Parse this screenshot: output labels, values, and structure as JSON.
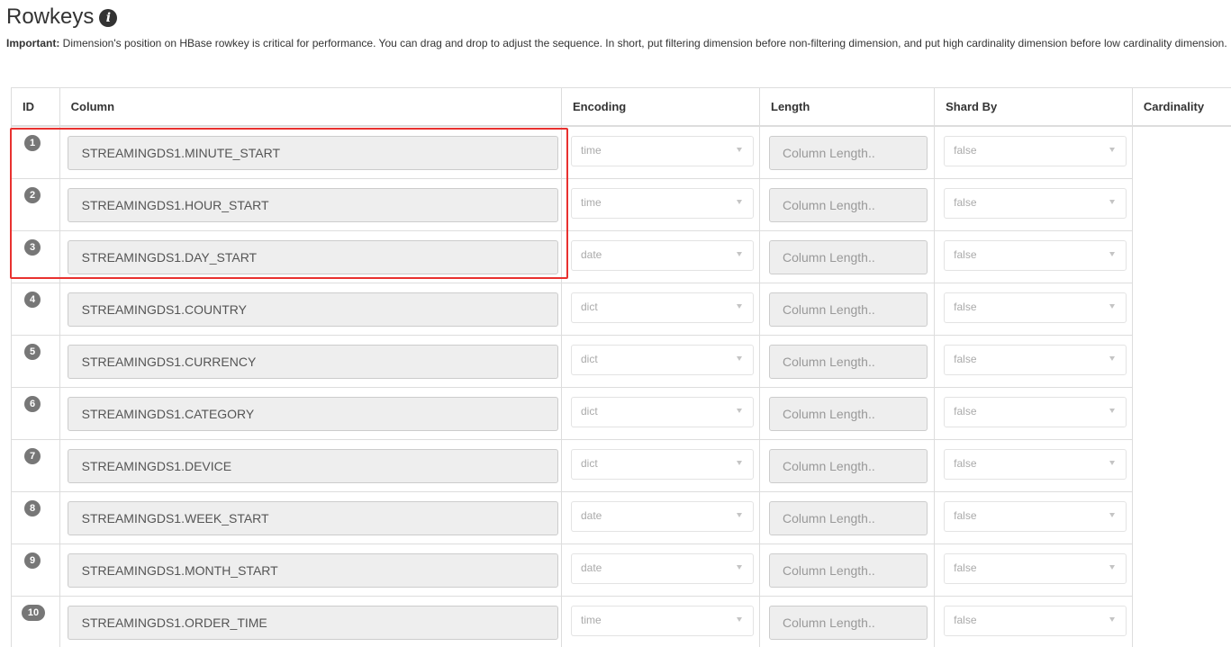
{
  "header": {
    "title": "Rowkeys",
    "info_icon": "info-circle-icon",
    "note_label": "Important:",
    "note_text": " Dimension's position on HBase rowkey is critical for performance. You can drag and drop to adjust the sequence. In short, put filtering dimension before non-filtering dimension, and put high cardinality dimension before low cardinality dimension."
  },
  "table": {
    "columns": [
      "ID",
      "Column",
      "Encoding",
      "Length",
      "Shard By",
      "Cardinality"
    ],
    "length_placeholder": "Column Length..",
    "rows": [
      {
        "id": "1",
        "column": "STREAMINGDS1.MINUTE_START",
        "encoding": "time",
        "shard_by": "false"
      },
      {
        "id": "2",
        "column": "STREAMINGDS1.HOUR_START",
        "encoding": "time",
        "shard_by": "false"
      },
      {
        "id": "3",
        "column": "STREAMINGDS1.DAY_START",
        "encoding": "date",
        "shard_by": "false"
      },
      {
        "id": "4",
        "column": "STREAMINGDS1.COUNTRY",
        "encoding": "dict",
        "shard_by": "false"
      },
      {
        "id": "5",
        "column": "STREAMINGDS1.CURRENCY",
        "encoding": "dict",
        "shard_by": "false"
      },
      {
        "id": "6",
        "column": "STREAMINGDS1.CATEGORY",
        "encoding": "dict",
        "shard_by": "false"
      },
      {
        "id": "7",
        "column": "STREAMINGDS1.DEVICE",
        "encoding": "dict",
        "shard_by": "false"
      },
      {
        "id": "8",
        "column": "STREAMINGDS1.WEEK_START",
        "encoding": "date",
        "shard_by": "false"
      },
      {
        "id": "9",
        "column": "STREAMINGDS1.MONTH_START",
        "encoding": "date",
        "shard_by": "false"
      },
      {
        "id": "10",
        "column": "STREAMINGDS1.ORDER_TIME",
        "encoding": "time",
        "shard_by": "false"
      }
    ]
  },
  "colors": {
    "highlight": "#e8312f",
    "badge": "#777777"
  }
}
